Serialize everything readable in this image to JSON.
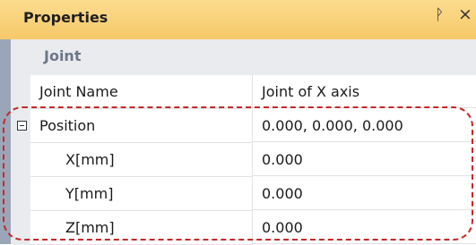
{
  "panel": {
    "title": "Properties",
    "pin_glyph": "ᚹ",
    "close_glyph": "×"
  },
  "category": {
    "label": "Joint"
  },
  "rows": [
    {
      "name": "Joint Name",
      "value": "Joint of X axis"
    },
    {
      "name": "Position",
      "value": "0.000, 0.000, 0.000",
      "expandable": true
    },
    {
      "name": "X[mm]",
      "value": "0.000"
    },
    {
      "name": "Y[mm]",
      "value": "0.000"
    },
    {
      "name": "Z[mm]",
      "value": "0.000"
    }
  ],
  "colors": {
    "titlebar": "#f6c869",
    "category_bg": "#e9ebef",
    "highlight": "#c62828"
  }
}
